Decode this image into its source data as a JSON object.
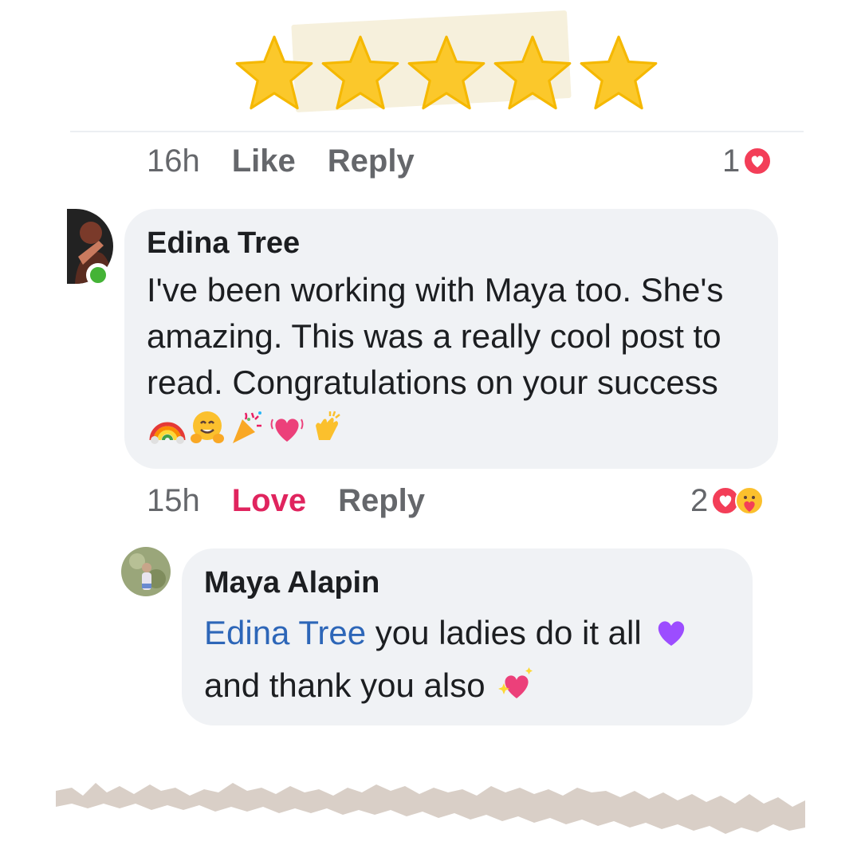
{
  "rating": {
    "stars": 5,
    "star_color": "#fbc82b"
  },
  "comment_top": {
    "time": "16h",
    "like_label": "Like",
    "reply_label": "Reply",
    "reaction_count": "1",
    "reaction_icon": "love-reaction-icon"
  },
  "comment_edina": {
    "author": "Edina Tree",
    "text": "I've been working with Maya too. She's amazing. This was a really cool post to read. Congratulations on your success",
    "emojis": [
      "rainbow",
      "hugging-face",
      "party-popper",
      "growing-heart",
      "clapping-hands"
    ],
    "time": "15h",
    "love_label": "Love",
    "reply_label": "Reply",
    "reaction_count": "2",
    "reaction_icons": [
      "love-reaction-icon",
      "care-reaction-icon"
    ],
    "online": true
  },
  "reply_maya": {
    "author": "Maya Alapin",
    "mention": "Edina Tree",
    "text_line1": " you ladies do it all",
    "text_line2": "and thank you also",
    "emojis": [
      "purple-heart",
      "sparkling-heart"
    ]
  },
  "colors": {
    "love": "#e0245e",
    "mention": "#2d66b8",
    "bubble": "#f0f2f5",
    "online": "#44b336",
    "meta_text": "#65676b"
  }
}
